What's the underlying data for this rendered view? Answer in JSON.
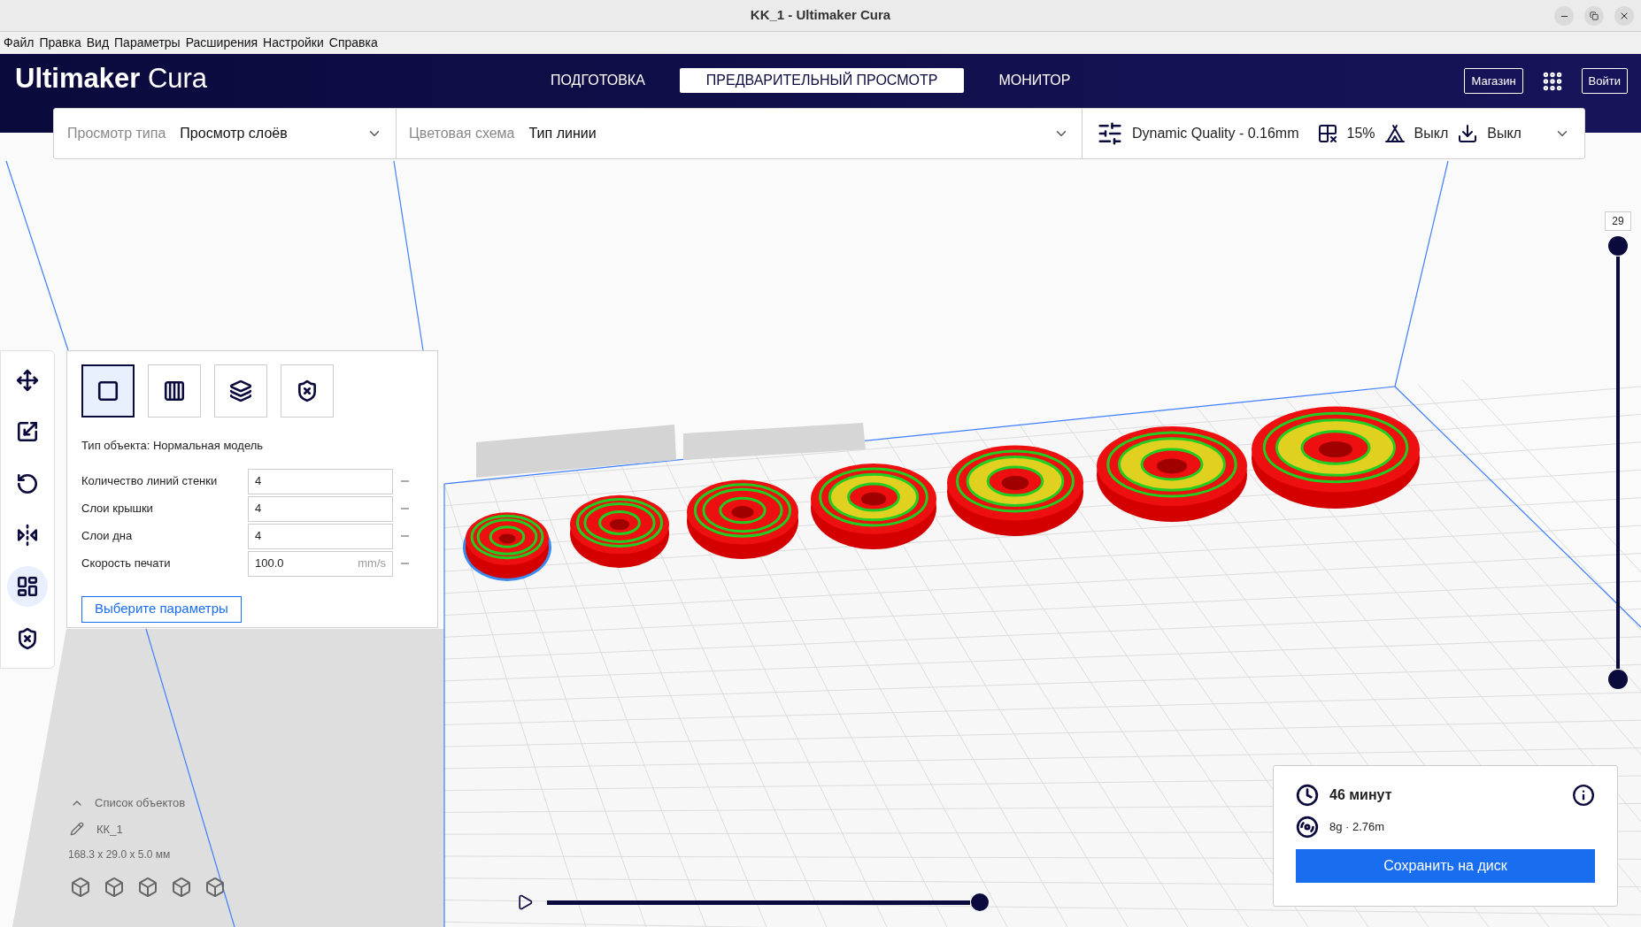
{
  "window": {
    "title": "KK_1 - Ultimaker Cura"
  },
  "menu": [
    "Файл",
    "Правка",
    "Вид",
    "Параметры",
    "Расширения",
    "Настройки",
    "Справка"
  ],
  "header": {
    "logo_brand": "Ultimaker",
    "logo_product": "Cura",
    "stages": [
      {
        "label": "ПОДГОТОВКА",
        "selected": false
      },
      {
        "label": "ПРЕДВАРИТЕЛЬНЫЙ ПРОСМОТР",
        "selected": true
      },
      {
        "label": "МОНИТОР",
        "selected": false
      }
    ],
    "marketplace_button": "Магазин",
    "signin_button": "Войти"
  },
  "view_bar": {
    "view_type_label": "Просмотр типа",
    "view_type_value": "Просмотр слоёв",
    "color_scheme_label": "Цветовая схема",
    "color_scheme_value": "Тип линии",
    "profile": "Dynamic Quality - 0.16mm",
    "infill": "15%",
    "support": "Выкл",
    "adhesion": "Выкл"
  },
  "tools": [
    {
      "selected": false
    },
    {
      "selected": false
    },
    {
      "selected": false
    },
    {
      "selected": false
    },
    {
      "selected": true
    },
    {
      "selected": false
    }
  ],
  "per_model_panel": {
    "mesh_types": [
      {
        "selected": true
      },
      {
        "selected": false
      },
      {
        "selected": false
      },
      {
        "selected": false
      }
    ],
    "object_type": "Тип объекта: Нормальная модель",
    "settings": [
      {
        "label": "Количество линий стенки",
        "value": "4"
      },
      {
        "label": "Слои крышки",
        "value": "4"
      },
      {
        "label": "Слои дна",
        "value": "4"
      },
      {
        "label": "Скорость печати",
        "value": "100.0",
        "unit": "mm/s"
      }
    ],
    "select_button": "Выберите параметры"
  },
  "object_list": {
    "title": "Список объектов",
    "expanded": true,
    "item": "КК_1",
    "dimensions": "168.3 x 29.0 x 5.0 мм"
  },
  "layer_slider": {
    "top_label": "29",
    "upper": {
      "level": 1
    },
    "lower": {
      "level": 0
    }
  },
  "simulation": {
    "level": 1
  },
  "print_summary": {
    "time": "46 минут",
    "material": "8g · 2.76m",
    "save_button": "Сохранить на диск"
  }
}
